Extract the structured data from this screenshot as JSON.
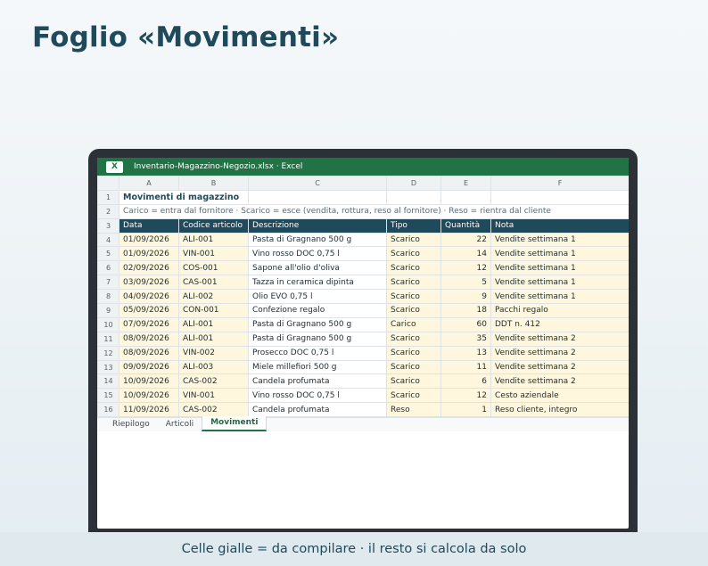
{
  "page": {
    "title": "Foglio «Movimenti»",
    "footer": "Celle gialle = da compilare · il resto si calcola da solo"
  },
  "window": {
    "app_badge": "X",
    "title": "Inventario-Magazzino-Negozio.xlsx · Excel"
  },
  "sheet": {
    "column_letters": [
      "A",
      "B",
      "C",
      "D",
      "E",
      "F"
    ],
    "title": "Movimenti di magazzino",
    "subtitle": "Carico = entra dal fornitore · Scarico = esce (vendita, rottura, reso al fornitore) · Reso = rientra dal cliente",
    "headers": [
      "Data",
      "Codice articolo",
      "Descrizione",
      "Tipo",
      "Quantità",
      "Nota"
    ],
    "rows": [
      {
        "n": "4",
        "data": "01/09/2026",
        "codice": "ALI-001",
        "descrizione": "Pasta di Gragnano 500 g",
        "tipo": "Scarico",
        "qta": "22",
        "nota": "Vendite settimana 1"
      },
      {
        "n": "5",
        "data": "01/09/2026",
        "codice": "VIN-001",
        "descrizione": "Vino rosso DOC 0,75 l",
        "tipo": "Scarico",
        "qta": "14",
        "nota": "Vendite settimana 1"
      },
      {
        "n": "6",
        "data": "02/09/2026",
        "codice": "COS-001",
        "descrizione": "Sapone all'olio d'oliva",
        "tipo": "Scarico",
        "qta": "12",
        "nota": "Vendite settimana 1"
      },
      {
        "n": "7",
        "data": "03/09/2026",
        "codice": "CAS-001",
        "descrizione": "Tazza in ceramica dipinta",
        "tipo": "Scarico",
        "qta": "5",
        "nota": "Vendite settimana 1"
      },
      {
        "n": "8",
        "data": "04/09/2026",
        "codice": "ALI-002",
        "descrizione": "Olio EVO 0,75 l",
        "tipo": "Scarico",
        "qta": "9",
        "nota": "Vendite settimana 1"
      },
      {
        "n": "9",
        "data": "05/09/2026",
        "codice": "CON-001",
        "descrizione": "Confezione regalo",
        "tipo": "Scarico",
        "qta": "18",
        "nota": "Pacchi regalo"
      },
      {
        "n": "10",
        "data": "07/09/2026",
        "codice": "ALI-001",
        "descrizione": "Pasta di Gragnano 500 g",
        "tipo": "Carico",
        "qta": "60",
        "nota": "DDT n. 412"
      },
      {
        "n": "11",
        "data": "08/09/2026",
        "codice": "ALI-001",
        "descrizione": "Pasta di Gragnano 500 g",
        "tipo": "Scarico",
        "qta": "35",
        "nota": "Vendite settimana 2"
      },
      {
        "n": "12",
        "data": "08/09/2026",
        "codice": "VIN-002",
        "descrizione": "Prosecco DOC 0,75 l",
        "tipo": "Scarico",
        "qta": "13",
        "nota": "Vendite settimana 2"
      },
      {
        "n": "13",
        "data": "09/09/2026",
        "codice": "ALI-003",
        "descrizione": "Miele millefiori 500 g",
        "tipo": "Scarico",
        "qta": "11",
        "nota": "Vendite settimana 2"
      },
      {
        "n": "14",
        "data": "10/09/2026",
        "codice": "CAS-002",
        "descrizione": "Candela profumata",
        "tipo": "Scarico",
        "qta": "6",
        "nota": "Vendite settimana 2"
      },
      {
        "n": "15",
        "data": "10/09/2026",
        "codice": "VIN-001",
        "descrizione": "Vino rosso DOC 0,75 l",
        "tipo": "Scarico",
        "qta": "12",
        "nota": "Cesto aziendale"
      },
      {
        "n": "16",
        "data": "11/09/2026",
        "codice": "CAS-002",
        "descrizione": "Candela profumata",
        "tipo": "Reso",
        "qta": "1",
        "nota": "Reso cliente, integro"
      }
    ],
    "tabs": [
      {
        "label": "Riepilogo",
        "active": false
      },
      {
        "label": "Articoli",
        "active": false
      },
      {
        "label": "Movimenti",
        "active": true
      }
    ]
  },
  "colors": {
    "excel_green": "#217346",
    "header_navy": "#1e4a5c",
    "input_yellow": "#fff7dd"
  }
}
